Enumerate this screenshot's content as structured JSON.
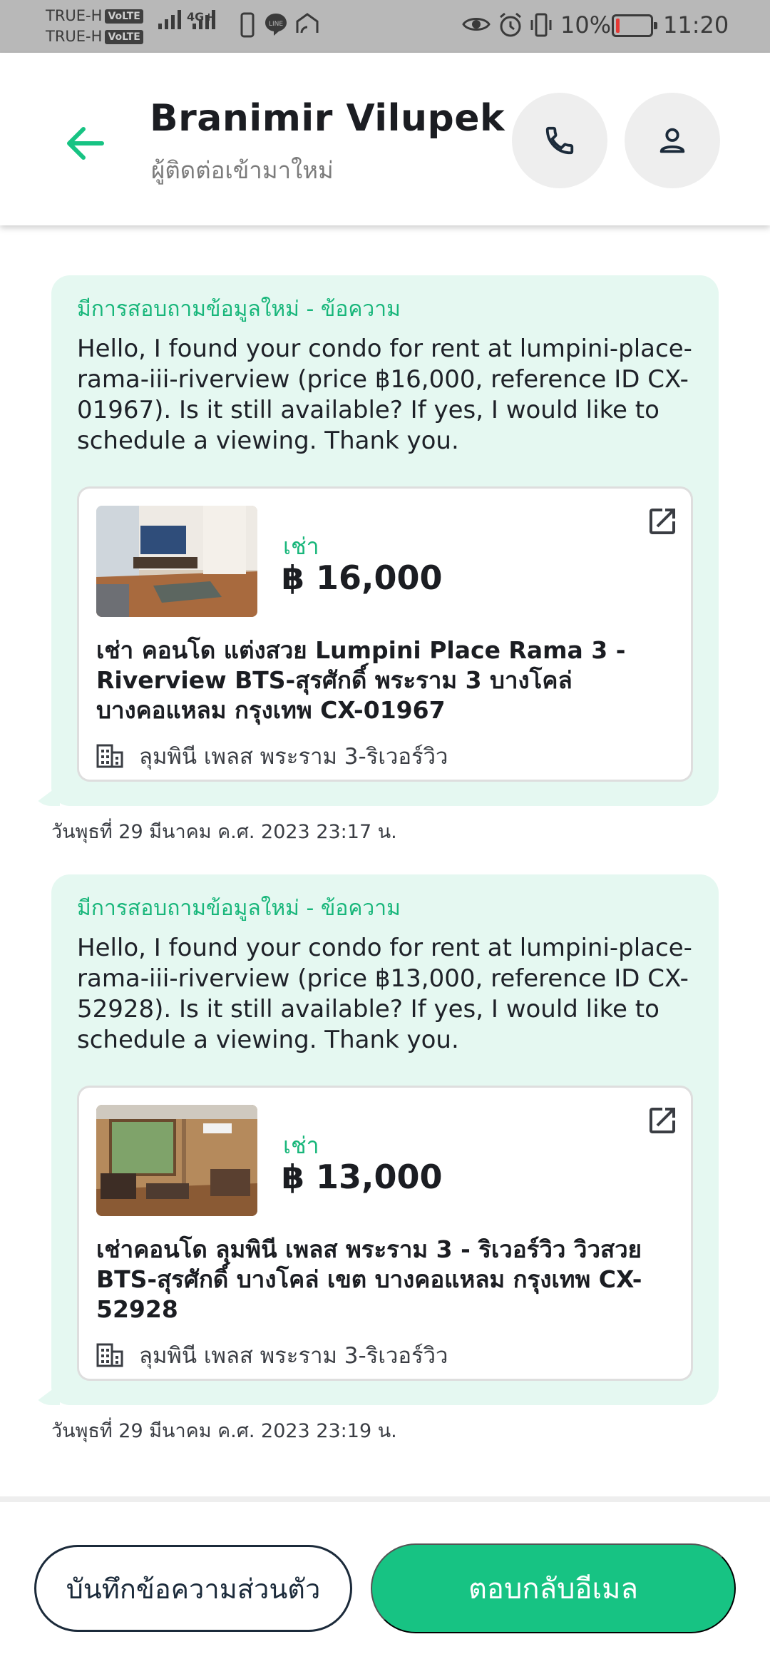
{
  "status_bar": {
    "carrier_1": "TRUE-H",
    "carrier_2": "TRUE-H",
    "volte_badge": "VoLTE",
    "network_label": "4G+",
    "battery_text": "10%",
    "battery_level": 0.1,
    "time": "11:20",
    "icons": [
      "signal-icon",
      "phone-icon",
      "line-app-icon",
      "cast-icon",
      "eye-icon",
      "alarm-icon",
      "vibrate-icon",
      "battery-icon"
    ]
  },
  "header": {
    "contact_name": "Branimir Vilupek",
    "contact_subtitle": "ผู้ติดต่อเข้ามาใหม่",
    "icons": [
      "back-arrow-icon",
      "phone-icon",
      "person-icon"
    ]
  },
  "messages": [
    {
      "kicker": "มีการสอบถามข้อมูลใหม่ - ข้อความ",
      "text": "Hello, I found your condo for rent at lumpini-place-rama-iii-riverview (price ฿16,000, reference ID CX-01967). Is it still available? If yes, I would like to schedule a viewing. Thank you.",
      "listing": {
        "type": "เช่า",
        "price": "฿ 16,000",
        "title": "เช่า คอนโด แต่งสวย Lumpini Place Rama 3 - Riverview BTS-สุรศักดิ์ พระราม 3 บางโคล่ บางคอแหลม กรุงเทพ CX-01967",
        "project": "ลุมพินี เพลส พระราม 3-ริเวอร์วิว"
      },
      "timestamp": "วันพุธที่ 29 มีนาคม ค.ศ. 2023 23:17 น."
    },
    {
      "kicker": "มีการสอบถามข้อมูลใหม่ - ข้อความ",
      "text": "Hello, I found your condo for rent at lumpini-place-rama-iii-riverview (price ฿13,000, reference ID CX-52928). Is it still available? If yes, I would like to schedule a viewing. Thank you.",
      "listing": {
        "type": "เช่า",
        "price": "฿ 13,000",
        "title": "เช่าคอนโด  ลุมพินี เพลส พระราม 3 - ริเวอร์วิว วิวสวย BTS-สุรศักดิ์ บางโคล่ เขต บางคอแหลม กรุงเทพ CX-52928",
        "project": "ลุมพินี เพลส พระราม 3-ริเวอร์วิว"
      },
      "timestamp": "วันพุธที่ 29 มีนาคม ค.ศ. 2023 23:19 น."
    }
  ],
  "footer": {
    "note_button": "บันทึกข้อความส่วนตัว",
    "reply_button": "ตอบกลับอีเมล"
  },
  "colors": {
    "accent": "#17c383",
    "accent_text": "#17b67a",
    "bubble_bg": "#e5f8f1",
    "status_bar_bg": "#b8b8b8",
    "battery_low": "#e53935"
  }
}
